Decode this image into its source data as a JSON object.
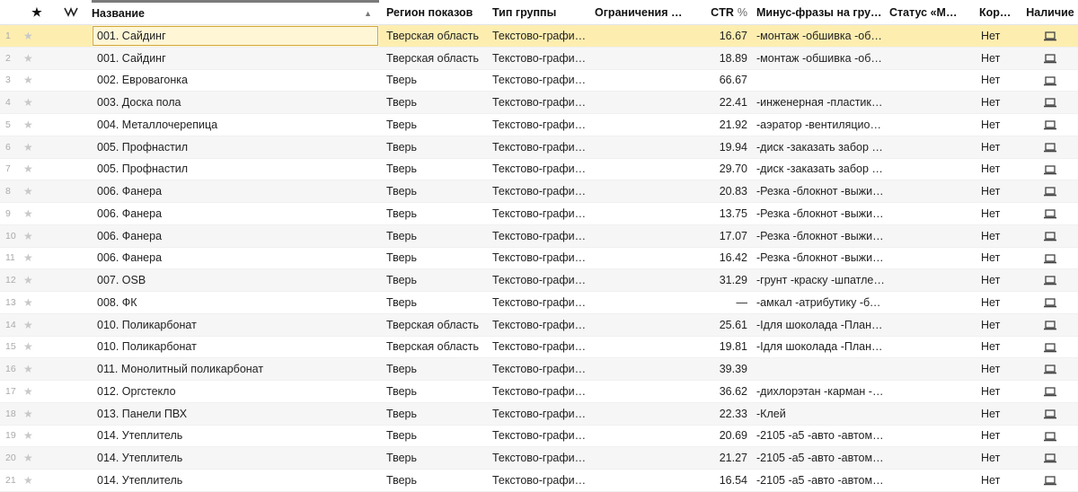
{
  "columns": {
    "star": "★",
    "name": "Название",
    "region": "Регион показов",
    "group_type": "Тип группы",
    "limits": "Ограничения в…",
    "ctr": "CTR",
    "ctr_unit": "%",
    "minus": "Минус-фразы на гру…",
    "status": "Статус «М…",
    "basket": "Кор…",
    "availability": "Наличие"
  },
  "rows": [
    {
      "n": "1",
      "name": "001. Сайдинг",
      "region": "Тверская область",
      "type": "Текстово-графич…",
      "ctr": "16.67",
      "minus": "-монтаж -обшивка -обш…",
      "basket": "Нет",
      "selected": true
    },
    {
      "n": "2",
      "name": "001. Сайдинг",
      "region": "Тверская область",
      "type": "Текстово-графич…",
      "ctr": "18.89",
      "minus": "-монтаж -обшивка -обш…",
      "basket": "Нет"
    },
    {
      "n": "3",
      "name": "002. Евровагонка",
      "region": "Тверь",
      "type": "Текстово-графич…",
      "ctr": "66.67",
      "minus": "",
      "basket": "Нет"
    },
    {
      "n": "4",
      "name": "003. Доска пола",
      "region": "Тверь",
      "type": "Текстово-графич…",
      "ctr": "22.41",
      "minus": "-инженерная -пластико…",
      "basket": "Нет"
    },
    {
      "n": "5",
      "name": "004. Металлочерепица",
      "region": "Тверь",
      "type": "Текстово-графич…",
      "ctr": "21.92",
      "minus": "-аэратор -вентиляцион…",
      "basket": "Нет"
    },
    {
      "n": "6",
      "name": "005. Профнастил",
      "region": "Тверь",
      "type": "Текстово-графич…",
      "ctr": "19.94",
      "minus": "-диск -заказать забор -з…",
      "basket": "Нет"
    },
    {
      "n": "7",
      "name": "005. Профнастил",
      "region": "Тверь",
      "type": "Текстово-графич…",
      "ctr": "29.70",
      "minus": "-диск -заказать забор -з…",
      "basket": "Нет"
    },
    {
      "n": "8",
      "name": "006. Фанера",
      "region": "Тверь",
      "type": "Текстово-графич…",
      "ctr": "20.83",
      "minus": "-Резка -блокнот -выжиг…",
      "basket": "Нет"
    },
    {
      "n": "9",
      "name": "006. Фанера",
      "region": "Тверь",
      "type": "Текстово-графич…",
      "ctr": "13.75",
      "minus": "-Резка -блокнот -выжиг…",
      "basket": "Нет"
    },
    {
      "n": "10",
      "name": "006. Фанера",
      "region": "Тверь",
      "type": "Текстово-графич…",
      "ctr": "17.07",
      "minus": "-Резка -блокнот -выжиг…",
      "basket": "Нет"
    },
    {
      "n": "11",
      "name": "006. Фанера",
      "region": "Тверь",
      "type": "Текстово-графич…",
      "ctr": "16.42",
      "minus": "-Резка -блокнот -выжиг…",
      "basket": "Нет"
    },
    {
      "n": "12",
      "name": "007. OSB",
      "region": "Тверь",
      "type": "Текстово-графич…",
      "ctr": "31.29",
      "minus": "-грунт -краску -шпатлевка",
      "basket": "Нет"
    },
    {
      "n": "13",
      "name": "008. ФК",
      "region": "Тверь",
      "type": "Текстово-графич…",
      "ctr": "—",
      "minus": "-амкал -атрибутику -ба…",
      "basket": "Нет"
    },
    {
      "n": "14",
      "name": "010. Поликарбонат",
      "region": "Тверская область",
      "type": "Текстово-графич…",
      "ctr": "25.61",
      "minus": "-Ідля шоколада -Планк…",
      "basket": "Нет"
    },
    {
      "n": "15",
      "name": "010. Поликарбонат",
      "region": "Тверская область",
      "type": "Текстово-графич…",
      "ctr": "19.81",
      "minus": "-Ідля шоколада -Планк…",
      "basket": "Нет"
    },
    {
      "n": "16",
      "name": "011. Монолитный поликарбонат",
      "region": "Тверь",
      "type": "Текстово-графич…",
      "ctr": "39.39",
      "minus": "",
      "basket": "Нет"
    },
    {
      "n": "17",
      "name": "012. Оргстекло",
      "region": "Тверь",
      "type": "Текстово-графич…",
      "ctr": "36.62",
      "minus": "-дихлорэтан -карман -к…",
      "basket": "Нет"
    },
    {
      "n": "18",
      "name": "013. Панели ПВХ",
      "region": "Тверь",
      "type": "Текстово-графич…",
      "ctr": "22.33",
      "minus": "-Клей",
      "basket": "Нет"
    },
    {
      "n": "19",
      "name": "014. Утеплитель",
      "region": "Тверь",
      "type": "Текстово-графич…",
      "ctr": "20.69",
      "minus": "-2105 -а5 -авто -автомо…",
      "basket": "Нет"
    },
    {
      "n": "20",
      "name": "014. Утеплитель",
      "region": "Тверь",
      "type": "Текстово-графич…",
      "ctr": "21.27",
      "minus": "-2105 -а5 -авто -автомо…",
      "basket": "Нет"
    },
    {
      "n": "21",
      "name": "014. Утеплитель",
      "region": "Тверь",
      "type": "Текстово-графич…",
      "ctr": "16.54",
      "minus": "-2105 -а5 -авто -автомо…",
      "basket": "Нет"
    }
  ]
}
